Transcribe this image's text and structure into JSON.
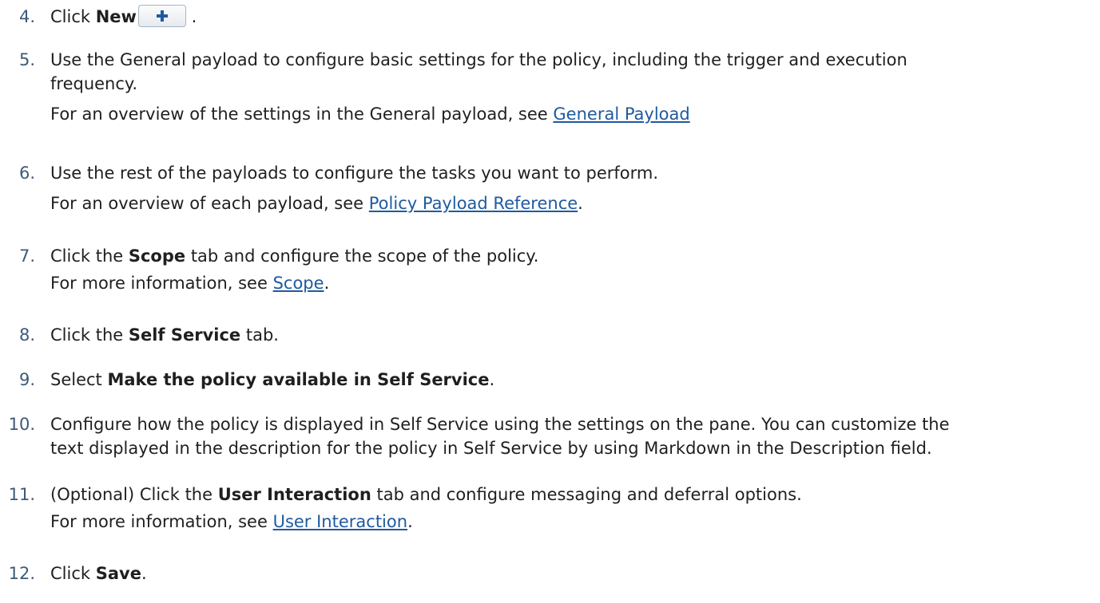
{
  "steps": [
    {
      "number": "4.",
      "pre": "Click ",
      "bold": "New",
      "post": " ."
    },
    {
      "number": "5.",
      "line1": "Use the General payload to configure basic settings for the policy, including the trigger and execution",
      "line2": "frequency.",
      "sub_pre": "For an overview of the settings in the General payload, see ",
      "sub_link": "General Payload",
      "sub_post": ""
    },
    {
      "number": "6.",
      "line1": "Use the rest of the payloads to configure the tasks you want to perform.",
      "sub_pre": "For an overview of each payload, see ",
      "sub_link": "Policy Payload Reference",
      "sub_post": "."
    },
    {
      "number": "7.",
      "pre": "Click the ",
      "bold": "Scope",
      "post": " tab and configure the scope of the policy.",
      "sub_pre": "For more information, see ",
      "sub_link": "Scope",
      "sub_post": "."
    },
    {
      "number": "8.",
      "pre": "Click the ",
      "bold": "Self Service",
      "post": " tab."
    },
    {
      "number": "9.",
      "pre": "Select ",
      "bold": "Make the policy available in Self Service",
      "post": "."
    },
    {
      "number": "10.",
      "line1": "Configure how the policy is displayed in Self Service using the settings on the pane. You can customize the",
      "line2": "text displayed in the description for the policy in Self Service by using Markdown in the Description field."
    },
    {
      "number": "11.",
      "pre": "(Optional) Click the ",
      "bold": "User Interaction",
      "post": " tab and configure messaging and deferral options.",
      "sub_pre": "For more information, see ",
      "sub_link": "User Interaction",
      "sub_post": "."
    },
    {
      "number": "12.",
      "pre": "Click ",
      "bold": "Save",
      "post": "."
    }
  ],
  "icons": {
    "new_button_icon": "plus-icon"
  },
  "colors": {
    "text": "#1f1f1f",
    "number": "#3c5a7a",
    "link": "#1f5aa0",
    "plus": "#1f5aa0"
  }
}
